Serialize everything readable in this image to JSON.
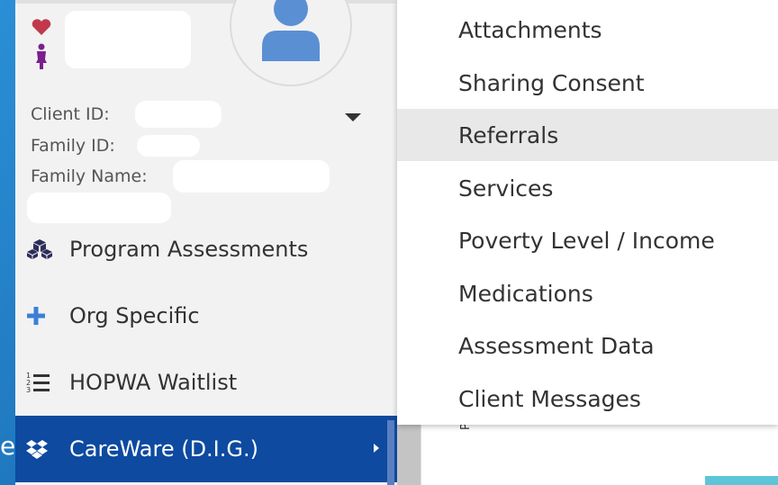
{
  "client": {
    "client_id_label": "Client ID:",
    "family_id_label": "Family ID:",
    "family_name_label": "Family Name:"
  },
  "icons": {
    "heart": "heart-icon",
    "person": "person-icon",
    "avatar": "avatar-icon",
    "caret": "caret-down-icon"
  },
  "sidebar": {
    "items": [
      {
        "label": "Program Assessments",
        "icon": "cubes-icon"
      },
      {
        "label": "Org Specific",
        "icon": "plus-icon"
      },
      {
        "label": "HOPWA Waitlist",
        "icon": "numbered-list-icon"
      },
      {
        "label": "CareWare (D.I.G.)",
        "icon": "dropbox-icon",
        "active": true
      }
    ]
  },
  "submenu": {
    "items": [
      {
        "label": "Attachments"
      },
      {
        "label": "Sharing Consent"
      },
      {
        "label": "Referrals",
        "hover": true
      },
      {
        "label": "Services"
      },
      {
        "label": "Poverty Level / Income"
      },
      {
        "label": "Medications"
      },
      {
        "label": "Assessment Data"
      },
      {
        "label": "Client Messages"
      }
    ]
  },
  "background": {
    "edge_letter": "e",
    "rotated_text": "Pr"
  },
  "colors": {
    "active_bg": "#0d4aa0",
    "heart": "#c0394b",
    "person": "#7a1f8e",
    "avatar": "#5b8fd4",
    "plus": "#3b7fd8"
  }
}
